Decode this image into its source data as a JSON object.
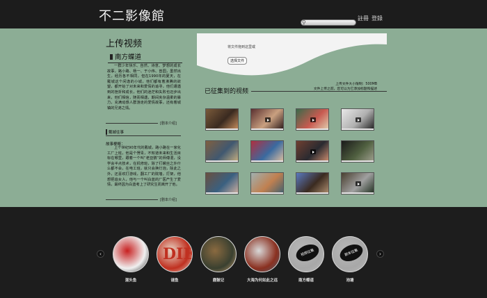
{
  "header": {
    "site_title": "不二影像館",
    "search": {
      "placeholder": ""
    },
    "register_label": "註冊",
    "login_label": "登錄"
  },
  "left": {
    "page_title": "上传视频",
    "section_title": "南方蝶道",
    "paragraph_1": "一群少年快乐、自然、诗意、梦想的成长故事，路小路、杨一、于小伟、曾园，虽然出生，经历各不相同，但在1990年的夏天，在戴城这个闲逸的小城，他们都有着沸腾的欲望，都开始了对未来和爱情的追寻，他们遭遇到的挫折和成长，他们的迷茫和失败也迈步出来，他们相信，随而相遇，期间夹杂温柔的暴力，充满动感人群游走的爱情故事，还有着城镇的兄弟之情。",
    "more_1": "[剧本介绍]",
    "sub_head": "戴城往事",
    "story_label": "故事梗概：",
    "paragraph_2": "上个世纪90年代的戴城，路小路在一家化工厂上班，他是个愣青，不知道未来和生活目标在哪里，跟着一个叫“老亚鹦”的师傅混，没学会半点技术，在机修班，除了打螺丝之外什么都不会，在电工班，就只会换灯泡，除此之外，还喜欢打游戏，翻工厂的院墙，打架，他想把追女人，他与一个叫白蓝的厂医产生了爱情，最终因为白蓝考上了研究生而离开了他。",
    "more_2": "[剧本介绍]"
  },
  "upload": {
    "drop_text": "将文件拖到这里或",
    "choose_button": "选择文件",
    "size_note_line1": "上传文件大小限制：500MB",
    "size_note_line2": "文件上传之前，您可以为它添加标题和描述"
  },
  "collected": {
    "title": "已征集到的视频",
    "thumbs": [
      {
        "colors": [
          "#7a5a3a",
          "#3a2a20",
          "#c99060"
        ],
        "play": false
      },
      {
        "colors": [
          "#5a3030",
          "#c9a080",
          "#2a1a1a"
        ],
        "play": true
      },
      {
        "colors": [
          "#3a6a4a",
          "#c85a50",
          "#e0d0b0"
        ],
        "play": true
      },
      {
        "colors": [
          "#e8e8e8",
          "#b0b0b0",
          "#202020"
        ],
        "play": true
      },
      {
        "colors": [
          "#806040",
          "#405870",
          "#c8b080"
        ],
        "play": false
      },
      {
        "colors": [
          "#b03040",
          "#3a6aa0",
          "#e0c0a0"
        ],
        "play": false
      },
      {
        "colors": [
          "#704030",
          "#2a2a30",
          "#d09070"
        ],
        "play": true
      },
      {
        "colors": [
          "#1a1a1a",
          "#506040",
          "#a0a090"
        ],
        "play": false
      },
      {
        "colors": [
          "#6a5040",
          "#3a6080",
          "#d0b0a0"
        ],
        "play": false
      },
      {
        "colors": [
          "#a0b0b0",
          "#c08050",
          "#406070"
        ],
        "play": false
      },
      {
        "colors": [
          "#5a7ac0",
          "#3a2a20",
          "#b09070"
        ],
        "play": false
      },
      {
        "colors": [
          "#4a4030",
          "#a0a0a0",
          "#203020"
        ],
        "play": true
      }
    ]
  },
  "carousel": {
    "prev_icon": "‹",
    "next_icon": "›",
    "films": [
      {
        "label": "混头鱼",
        "colors": [
          "#c82020",
          "#f0f0f0",
          "#202020"
        ],
        "bubble": ""
      },
      {
        "label": "谜鱼",
        "colors": [
          "#e8d8c8",
          "#c03020",
          "#e8d8c8"
        ],
        "bubble": ""
      },
      {
        "label": "鹿鼓记",
        "colors": [
          "#8a6a40",
          "#3a4030",
          "#c8a070"
        ],
        "bubble": ""
      },
      {
        "label": "大海为何如此之远",
        "colors": [
          "#d8d8d8",
          "#8a3020",
          "#506070"
        ],
        "bubble": ""
      },
      {
        "label": "南方蝶道",
        "colors": [
          "#b8b8b8",
          "#a8a8a8",
          "#b8b8b8"
        ],
        "bubble": "视频征集"
      },
      {
        "label": "池塘",
        "colors": [
          "#b8b8b8",
          "#a8a8a8",
          "#b8b8b8"
        ],
        "bubble": "剧本征集"
      }
    ],
    "die_text": "DIE"
  }
}
